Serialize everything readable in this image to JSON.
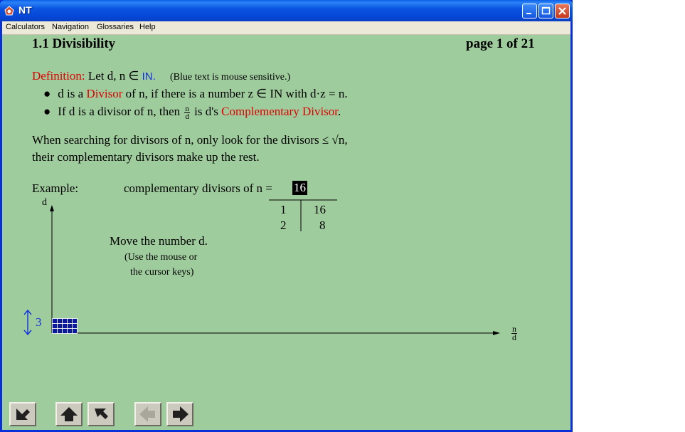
{
  "window": {
    "title": "NT"
  },
  "menu": {
    "items": [
      "Calculators",
      "Navigation",
      "Glossaries",
      "Help"
    ]
  },
  "page": {
    "heading": "1.1 Divisibility",
    "page_indicator": "page 1 of 21"
  },
  "definition": {
    "label": "Definition:",
    "let_text": "Let d, n ∈",
    "set_symbol": "IN.",
    "note": "(Blue text is mouse sensitive.)",
    "bullet1_pre": "d is a",
    "bullet1_term": "Divisor",
    "bullet1_post": "of n, if there is a number z ∈ IN with d·z = n.",
    "bullet2_pre": "If d is a divisor of n, then",
    "frac_num": "n",
    "frac_den": "d",
    "bullet2_mid": "is d's",
    "bullet2_term": "Complementary Divisor",
    "bullet2_end": "."
  },
  "text": {
    "search_line1": "When searching for divisors of n, only look for the divisors ≤ √n,",
    "search_line2": "their complementary divisors make up the rest."
  },
  "example": {
    "label": "Example:",
    "comp_label": "complementary divisors of n =",
    "n_value": "16",
    "table": [
      [
        "1",
        "16"
      ],
      [
        "2",
        "8"
      ]
    ]
  },
  "instructions": {
    "line1": "Move the number d.",
    "line2": "(Use the mouse or",
    "line3": "the cursor keys)"
  },
  "graph": {
    "y_axis_label": "d",
    "x_axis_num": "n",
    "x_axis_den": "d",
    "d_value": "3",
    "grid_rows": 3,
    "grid_cols": 5
  },
  "colors": {
    "content_bg": "#9fcc9d",
    "term_red": "#e00000",
    "link_blue": "#1030e0",
    "grid_blue": "#0a1a9a"
  },
  "nav": {
    "buttons": [
      "first-page-icon",
      "up-icon",
      "back-icon",
      "previous-icon",
      "next-icon"
    ]
  }
}
